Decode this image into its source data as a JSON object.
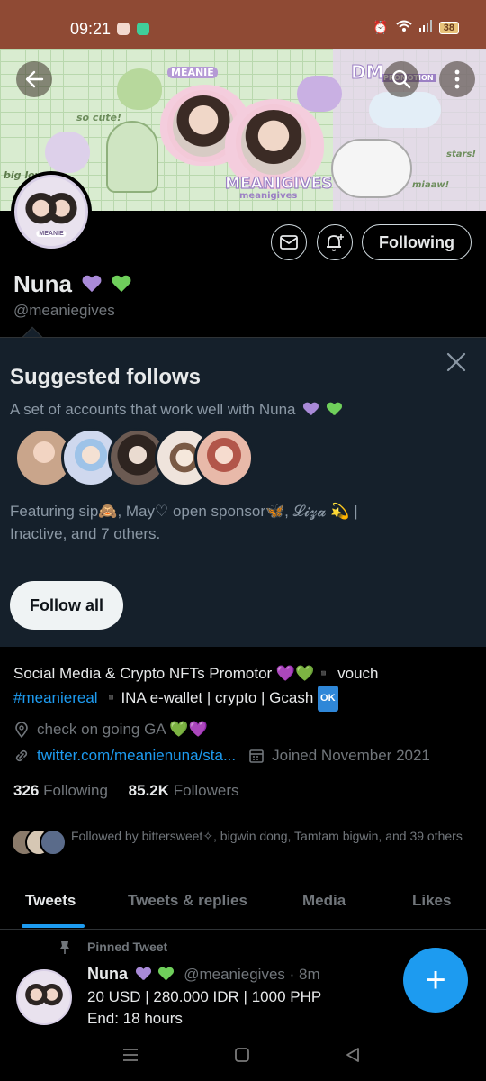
{
  "status_bar": {
    "time": "09:21",
    "battery": "38",
    "icons": [
      "chat-notification-icon",
      "app-notification-icon",
      "alarm-icon",
      "wifi-icon",
      "signal-icon",
      "battery-icon"
    ]
  },
  "banner": {
    "texts": [
      "MEANIE",
      "so cute!",
      "DM",
      "PROMOTION",
      "MEANIGIVES",
      "meanigives",
      "big love",
      "stars!",
      "miaaw!"
    ]
  },
  "profile": {
    "name": "Nuna",
    "handle": "@meaniegives",
    "following_button": "Following"
  },
  "suggested": {
    "title": "Suggested follows",
    "subtitle": "A set of accounts that work well with Nuna",
    "featuring": "Featuring sip🙈, May♡ open sponsor🦋, 𝓛𝓲𝔃𝓪 💫 | Inactive, and 7 others.",
    "follow_all": "Follow all",
    "avatar_colors": [
      "#c9a58b",
      "#cfd8ee",
      "#6b5a52",
      "#efe4dc",
      "#e8b9a9"
    ]
  },
  "bio": {
    "line1": "Social Media & Crypto NFTs Promotor 💜💚▪️ vouch",
    "hashtag": "#meaniereal",
    "line2_rest": " ▪️INA e-wallet | crypto | Gcash ",
    "ok": "OK",
    "location": "check on going GA 💚💜",
    "link": "twitter.com/meanienuna/sta...",
    "joined": "Joined November 2021"
  },
  "stats": {
    "following_count": "326",
    "following_label": "Following",
    "followers_count": "85.2K",
    "followers_label": "Followers"
  },
  "followed_by": "Followed by bittersweet✧, bigwin dong, Tamtam bigwin, and 39 others",
  "tabs": [
    "Tweets",
    "Tweets & replies",
    "Media",
    "Likes"
  ],
  "pinned": {
    "label": "Pinned Tweet",
    "name": "Nuna",
    "handle_time": "@meaniegives · 8m",
    "line1": "20 USD | 280.000 IDR | 1000 PHP",
    "line2": "End: 18 hours"
  },
  "fab": "+",
  "nav": [
    "menu-icon",
    "home-icon",
    "back-icon"
  ]
}
